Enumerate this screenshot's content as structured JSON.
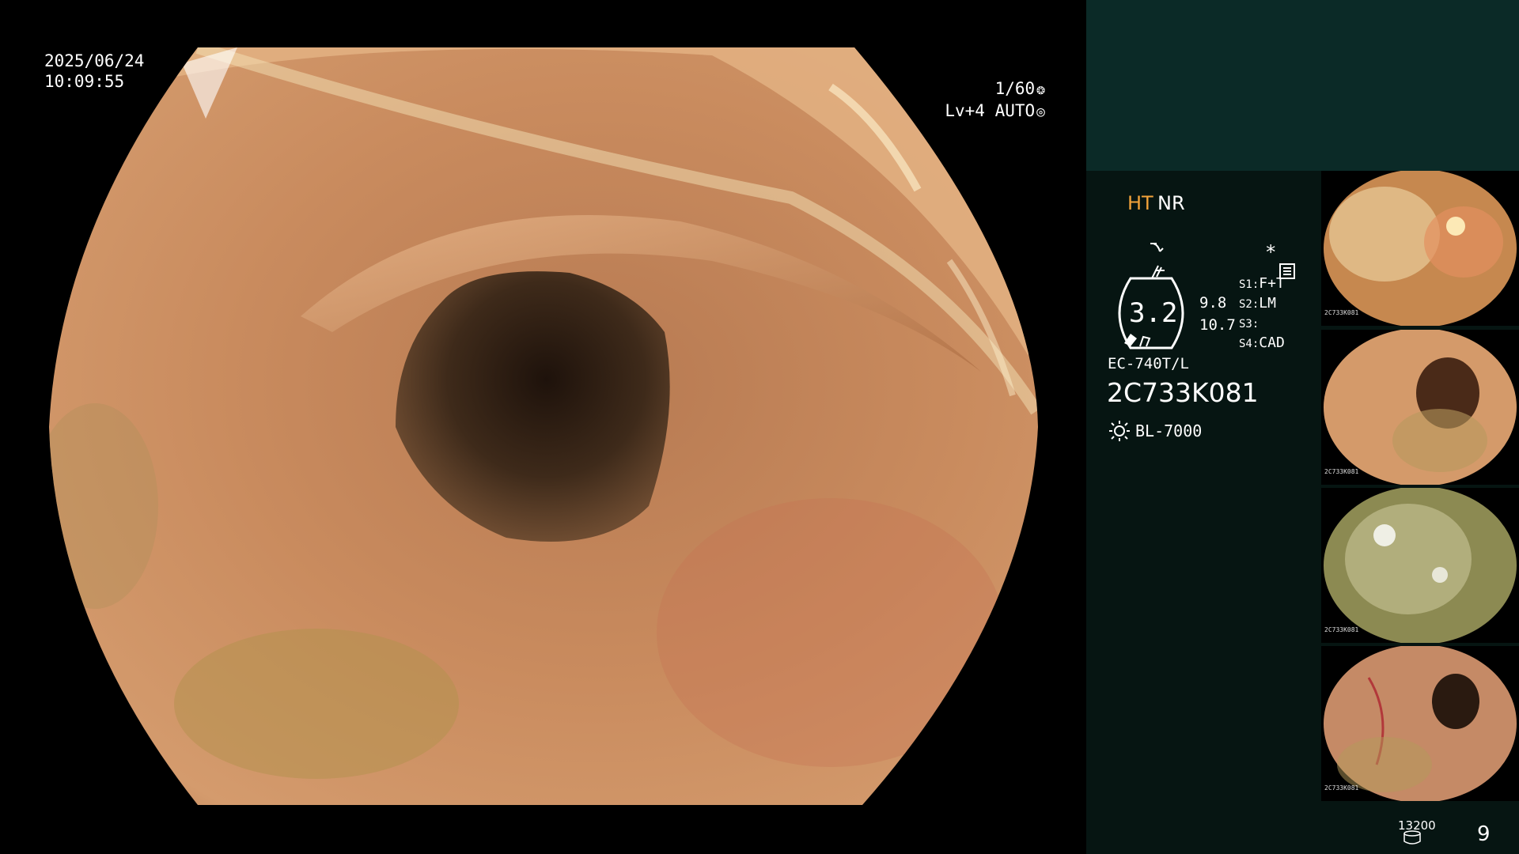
{
  "overlay": {
    "date": "2025/06/24",
    "time": "10:09:55",
    "shutter": "1/60",
    "shutter_icon": "aperture-icon",
    "level": "Lv+4 AUTO",
    "level_icon": "iris-icon"
  },
  "panel": {
    "mode_ht": "HT",
    "mode_nr": "NR",
    "mode_ht_color": "#f2a23a",
    "enhance_icon": "enhance-curve-icon",
    "curve_icon": "gamma-icon",
    "menu_icon": "settings-list-icon",
    "star": "*",
    "zoom": "3.2",
    "ratio_top": "9.8",
    "ratio_bottom": "10.7",
    "switches": [
      {
        "key": "S1:",
        "value": "F+T"
      },
      {
        "key": "S2:",
        "value": "LM"
      },
      {
        "key": "S3:",
        "value": ""
      },
      {
        "key": "S4:",
        "value": "CAD"
      }
    ],
    "scope_model": "EC-740T/L",
    "scope_serial": "2C733K081",
    "light_source_icon": "sun-icon",
    "light_source": "BL-7000",
    "storage_count": "13200",
    "storage_icon": "database-icon",
    "image_count": "9"
  },
  "thumbnails": [
    {
      "serial": "2C733K081"
    },
    {
      "serial": "2C733K081"
    },
    {
      "serial": "2C733K081"
    },
    {
      "serial": "2C733K081"
    }
  ],
  "colors": {
    "panel_bg": "#061512",
    "panel_top": "#0b2a27",
    "tissue": "#c7855a",
    "lumen": "#2a1a10"
  }
}
